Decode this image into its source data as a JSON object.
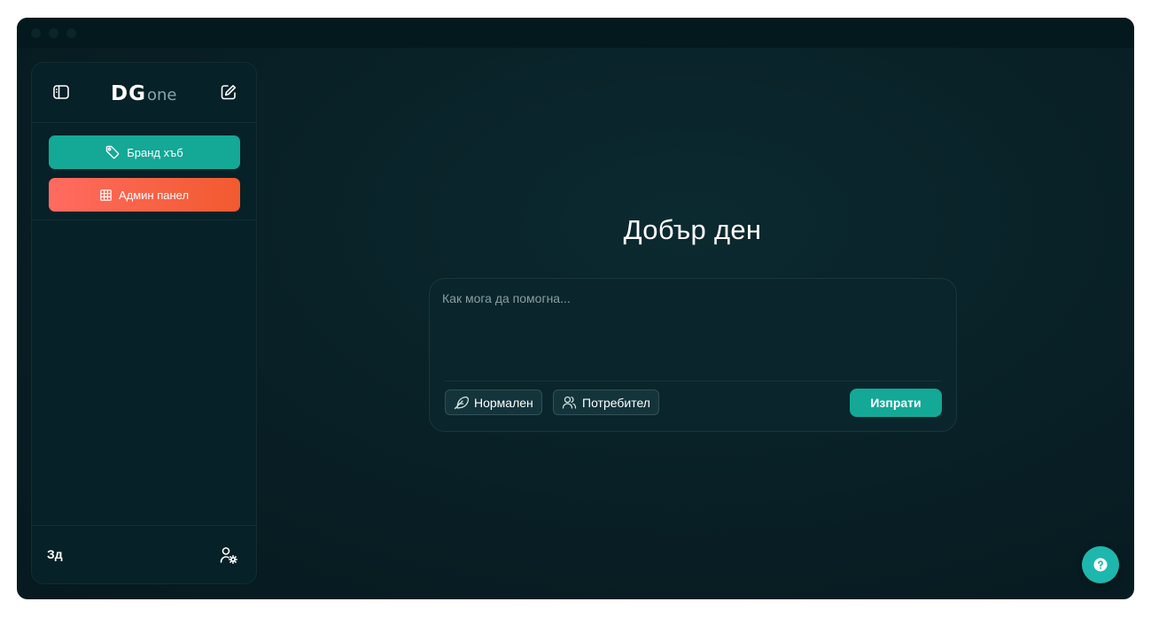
{
  "app": {
    "logo_main": "DG",
    "logo_sub": "one"
  },
  "sidebar": {
    "items": [
      {
        "label": "Бранд хъб",
        "icon": "tag-icon",
        "color": "#14a896"
      },
      {
        "label": "Админ панел",
        "icon": "grid-icon",
        "color": "#f25a2f"
      }
    ],
    "language": "Зд"
  },
  "main": {
    "greeting": "Добър ден",
    "chat": {
      "placeholder": "Как мога да помогна...",
      "mode_label": "Нормален",
      "role_label": "Потребител",
      "send_label": "Изпрати"
    }
  },
  "colors": {
    "accent": "#14a896",
    "danger_gradient_start": "#ff6b60",
    "danger_gradient_end": "#f25a2f",
    "background": "#081f25"
  }
}
